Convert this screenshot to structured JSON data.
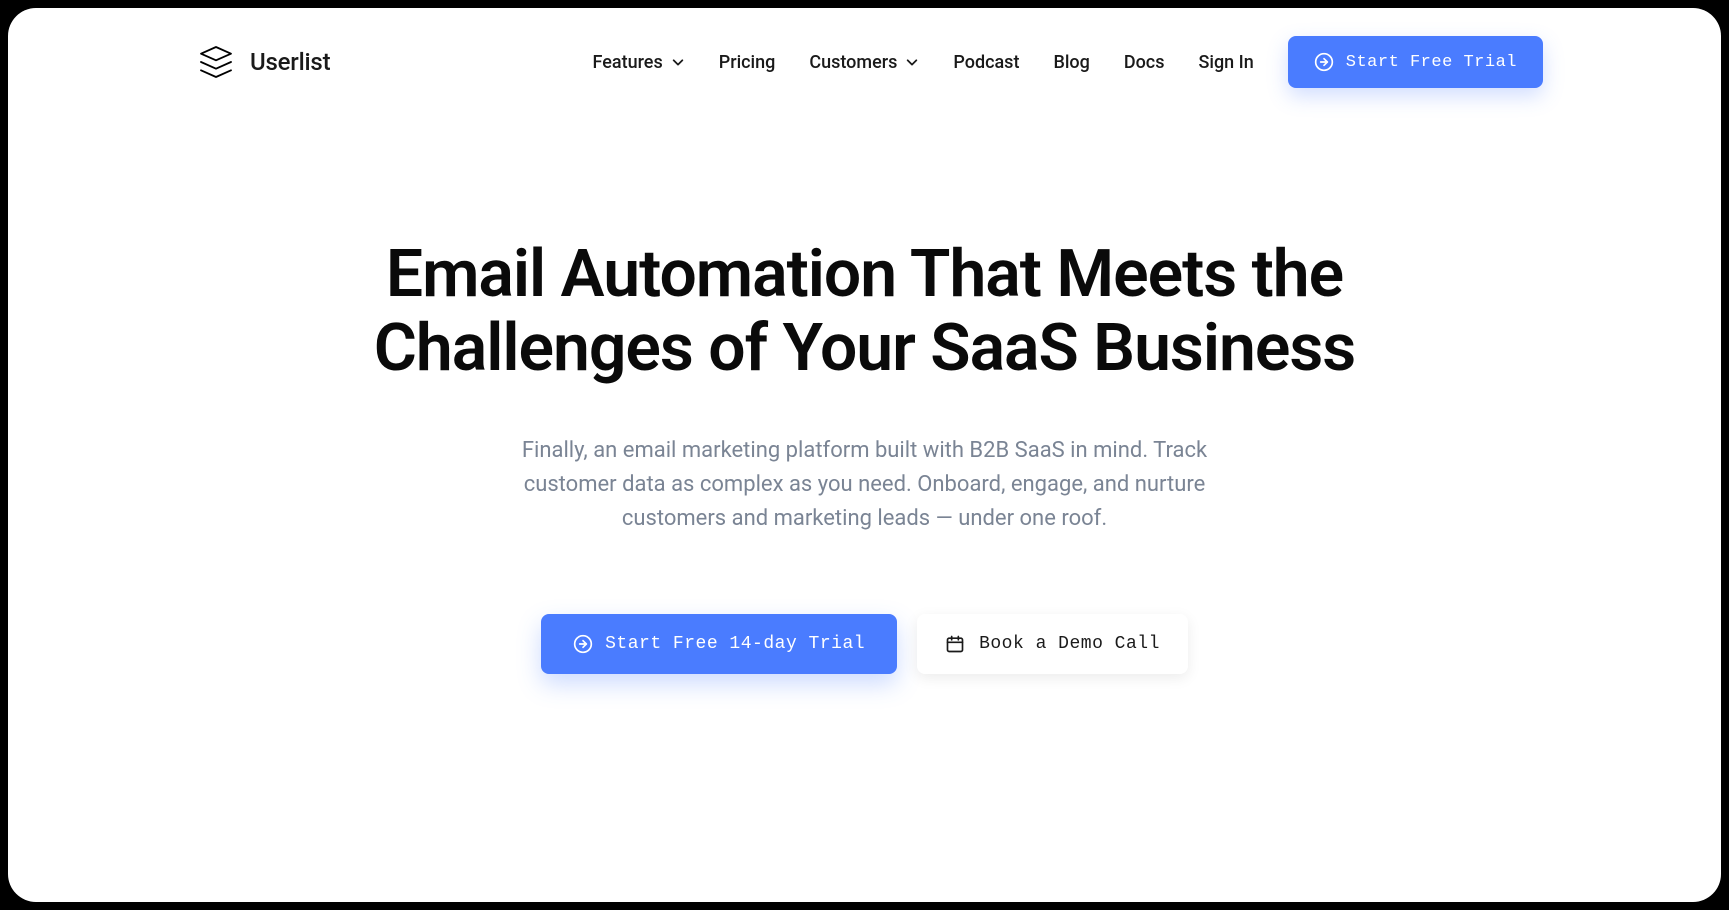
{
  "brand": "Userlist",
  "nav": {
    "features": "Features",
    "pricing": "Pricing",
    "customers": "Customers",
    "podcast": "Podcast",
    "blog": "Blog",
    "docs": "Docs",
    "signin": "Sign In",
    "cta": "Start Free Trial"
  },
  "hero": {
    "headline": "Email Automation That Meets the Challenges of Your SaaS Business",
    "sub": "Finally, an email marketing platform built with B2B SaaS in mind. Track customer data as complex as you need. Onboard, engage, and nurture customers and marketing leads — under one roof.",
    "primary_cta": "Start Free 14-day Trial",
    "secondary_cta": "Book a Demo Call"
  },
  "colors": {
    "accent": "#4a7cff"
  }
}
